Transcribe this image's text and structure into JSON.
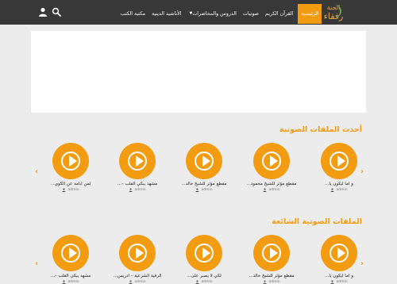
{
  "logo": {
    "line1": "الجنة",
    "line2": "رفقاء"
  },
  "nav": {
    "items": [
      {
        "label": "الرئيسية",
        "active": true,
        "has_caret": false
      },
      {
        "label": "القرآن الكريم",
        "active": false,
        "has_caret": false
      },
      {
        "label": "صوتيات",
        "active": false,
        "has_caret": false
      },
      {
        "label": "الدروس والمحاضرات",
        "active": false,
        "has_caret": true
      },
      {
        "label": "الأناشيد الدينية",
        "active": false,
        "has_caret": false
      },
      {
        "label": "مكتبة الكتب",
        "active": false,
        "has_caret": false
      }
    ],
    "icons": [
      "search-icon",
      "user-icon"
    ]
  },
  "sections": [
    {
      "title": "أحدث الملفات الصوتية",
      "cards": [
        {
          "title": "و اما ليكون يا...",
          "author": "admin"
        },
        {
          "title": "مقطع مؤثر للشيخ محمود...",
          "author": "admin"
        },
        {
          "title": "مقطع مؤثر للشيخ خالد...",
          "author": "admin"
        },
        {
          "title": "مشهد يبكي القلب –...",
          "author": "admin"
        },
        {
          "title": "لمن ابامه عن الكوي...",
          "author": "admin"
        }
      ]
    },
    {
      "title": "الملفات الصوتية الشائعة",
      "cards": [
        {
          "title": "و اما ليكون يا...",
          "author": "admin"
        },
        {
          "title": "مقطع مؤثر للشيخ خالد...",
          "author": "admin"
        },
        {
          "title": "لكي لا يصبر على...",
          "author": "admin"
        },
        {
          "title": "الرقية الشرعية – ادريس...",
          "author": "admin"
        },
        {
          "title": "مشهد يبكي القلب –...",
          "author": "admin"
        }
      ]
    }
  ],
  "colors": {
    "navbar": "#383838",
    "accent": "#f39c12",
    "background": "#ececec"
  }
}
